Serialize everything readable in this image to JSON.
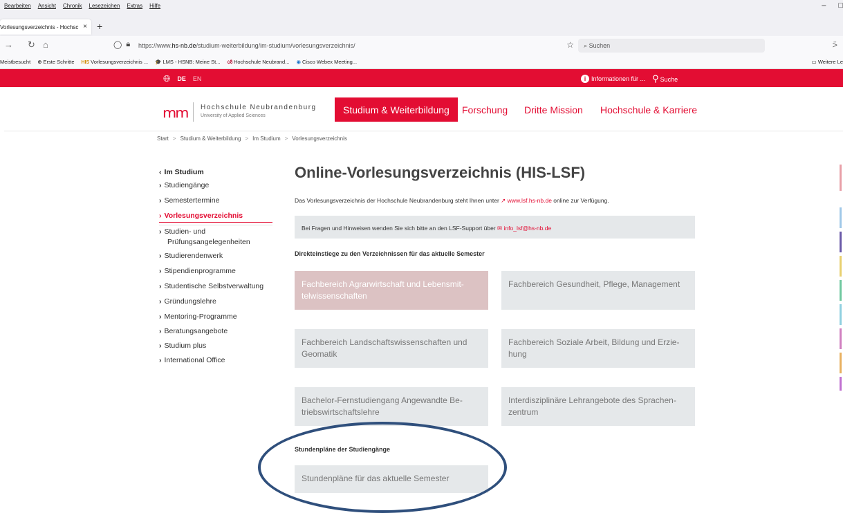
{
  "browser": {
    "menu": [
      "Bearbeiten",
      "Ansicht",
      "Chronik",
      "Lesezeichen",
      "Extras",
      "Hilfe"
    ],
    "window_controls": [
      "–",
      "□"
    ],
    "tab_title": "Vorlesungsverzeichnis - Hochsc",
    "tab_close": "×",
    "new_tab": "+",
    "url_prefix": "https://www.",
    "url_domain": "hs-nb.de",
    "url_path": "/studium-weiterbildung/im-studium/vorlesungsverzeichnis/",
    "search_placeholder": "Suchen",
    "bookmarks": [
      {
        "icon": "",
        "label": "Meistbesucht"
      },
      {
        "icon": "⊕",
        "label": "Erste Schritte"
      },
      {
        "icon": "HIS",
        "label": "Vorlesungsverzeichnis ..."
      },
      {
        "icon": "🎓",
        "label": "LMS - HSNB: Meine St..."
      },
      {
        "icon": "ൾ",
        "label": "Hochschule Neubrand..."
      },
      {
        "icon": "◉",
        "label": "Cisco Webex Meeting..."
      }
    ],
    "bookmarks_more": "Weitere Le"
  },
  "site": {
    "lang_de": "DE",
    "lang_en": "EN",
    "info_label": "Informationen für ...",
    "search_label": "Suche",
    "logo_name": "Hochschule Neubrandenburg",
    "logo_sub": "University of Applied Sciences",
    "nav": [
      "Studium & Weiterbildung",
      "Forschung",
      "Dritte Mission",
      "Hochschule & Karriere"
    ],
    "breadcrumb": [
      "Start",
      "Studium & Weiterbildung",
      "Im Studium",
      "Vorlesungsverzeichnis"
    ],
    "breadcrumb_sep": ">"
  },
  "sidebar": {
    "back": "Im Studium",
    "items": [
      "Studiengänge",
      "Semestertermine",
      "Vorlesungsverzeichnis",
      "Studien- und",
      "Prüfungsangelegenheiten",
      "Studierendenwerk",
      "Stipendienprogramme",
      "Studentische Selbstverwaltung",
      "Gründungslehre",
      "Mentoring-Programme",
      "Beratungsangebote",
      "Studium plus",
      "International Office"
    ]
  },
  "main": {
    "title": "Online-Vorlesungsverzeichnis (HIS-LSF)",
    "intro_before": "Das Vorlesungsverzeichnis der Hochschule Neubrandenburg steht Ihnen unter",
    "intro_link": "www.lsf.hs-nb.de",
    "intro_after": "online zur Verfügung.",
    "notice_before": "Bei Fragen und Hinweisen wenden Sie sich bitte an den LSF-Support über",
    "notice_link": "info_lsf@hs-nb.de",
    "direct_heading": "Direkteinstiege zu den Verzeichnissen für das aktuelle Semester",
    "tiles": [
      "Fachbereich Agrarwirtschaft und Lebensmit-telwissenschaften",
      "Fachbereich Gesundheit, Pflege, Management",
      "Fachbereich Landschaftswissenschaften und Geomatik",
      "Fachbereich Soziale Arbeit, Bildung und Erzie-hung",
      "Bachelor-Fernstudiengang Angewandte Be-triebswirtschaftslehre",
      "Interdisziplinäre Lehrangebote des Sprachen-zentrum"
    ],
    "schedule_heading": "Stundenpläne der Studiengänge",
    "schedule_tile": "Stundenpläne für das aktuelle Semester"
  },
  "colors": {
    "brand_red": "#e30d33",
    "highlight_ellipse": "#2f4f7c",
    "tile_grey": "#e5e8ea",
    "tile_pink": "#dcc2c3"
  },
  "icons": [
    "globe-icon",
    "info-icon",
    "search-icon",
    "back-arrow-icon",
    "forward-arrow-icon",
    "reload-icon",
    "home-icon",
    "shield-icon",
    "lock-icon",
    "star-icon",
    "external-link-icon",
    "mail-icon",
    "chevron-right-icon"
  ]
}
